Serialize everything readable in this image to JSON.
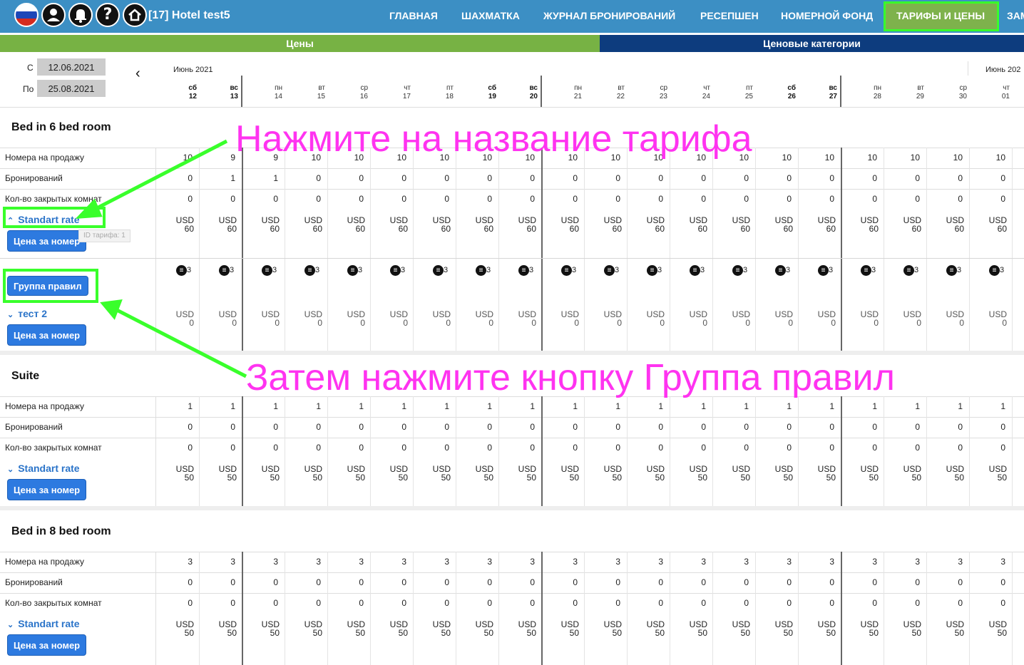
{
  "header": {
    "icons": [
      "flag-icon",
      "profile-icon",
      "bell-icon",
      "help-icon",
      "home-icon"
    ],
    "hotel_name": "[17] Hotel test5",
    "nav": [
      "ГЛАВНАЯ",
      "ШАХМАТКА",
      "ЖУРНАЛ БРОНИРОВАНИЙ",
      "РЕСЕПШЕН",
      "НОМЕРНОЙ ФОНД",
      "ТАРИФЫ И ЦЕНЫ",
      "ЗАМ"
    ],
    "active_nav": "ТАРИФЫ И ЦЕНЫ"
  },
  "tabs": {
    "prices": "Цены",
    "categories": "Ценовые категории"
  },
  "filter": {
    "from_label": "С",
    "from_value": "12.06.2021",
    "to_label": "По",
    "to_value": "25.08.2021",
    "prev": "‹"
  },
  "calendar": {
    "month": "Июнь 2021",
    "month_next": "Июнь 202",
    "days": [
      {
        "wd": "сб",
        "d": "12"
      },
      {
        "wd": "вс",
        "d": "13"
      },
      {
        "wd": "пн",
        "d": "14"
      },
      {
        "wd": "вт",
        "d": "15"
      },
      {
        "wd": "ср",
        "d": "16"
      },
      {
        "wd": "чт",
        "d": "17"
      },
      {
        "wd": "пт",
        "d": "18"
      },
      {
        "wd": "сб",
        "d": "19"
      },
      {
        "wd": "вс",
        "d": "20"
      },
      {
        "wd": "пн",
        "d": "21"
      },
      {
        "wd": "вт",
        "d": "22"
      },
      {
        "wd": "ср",
        "d": "23"
      },
      {
        "wd": "чт",
        "d": "24"
      },
      {
        "wd": "пт",
        "d": "25"
      },
      {
        "wd": "сб",
        "d": "26"
      },
      {
        "wd": "вс",
        "d": "27"
      },
      {
        "wd": "пн",
        "d": "28"
      },
      {
        "wd": "вт",
        "d": "29"
      },
      {
        "wd": "ср",
        "d": "30"
      },
      {
        "wd": "чт",
        "d": "01"
      }
    ]
  },
  "row_labels": {
    "sale": "Номера на продажу",
    "bookings": "Бронирований",
    "closed": "Кол-во закрытых комнат"
  },
  "currency": "USD",
  "price_button": "Цена за номер",
  "rules_button": "Группа правил",
  "rules_symbol": "3",
  "tooltip": "ID тарифа: 1",
  "rooms": [
    {
      "name": "Bed in 6 bed room",
      "sale": [
        "10",
        "9",
        "9",
        "10",
        "10",
        "10",
        "10",
        "10",
        "10",
        "10",
        "10",
        "10",
        "10",
        "10",
        "10",
        "10",
        "10",
        "10",
        "10",
        "10"
      ],
      "bookings": [
        "0",
        "1",
        "1",
        "0",
        "0",
        "0",
        "0",
        "0",
        "0",
        "0",
        "0",
        "0",
        "0",
        "0",
        "0",
        "0",
        "0",
        "0",
        "0",
        "0"
      ],
      "closed": [
        "0",
        "0",
        "0",
        "0",
        "0",
        "0",
        "0",
        "0",
        "0",
        "0",
        "0",
        "0",
        "0",
        "0",
        "0",
        "0",
        "0",
        "0",
        "0",
        "0"
      ],
      "rates": [
        {
          "name": "Standart rate",
          "expanded": true,
          "price": "60"
        },
        {
          "name": "тест 2",
          "expanded": false,
          "price": "0"
        }
      ]
    },
    {
      "name": "Suite",
      "sale": [
        "1",
        "1",
        "1",
        "1",
        "1",
        "1",
        "1",
        "1",
        "1",
        "1",
        "1",
        "1",
        "1",
        "1",
        "1",
        "1",
        "1",
        "1",
        "1",
        "1"
      ],
      "bookings": [
        "0",
        "0",
        "0",
        "0",
        "0",
        "0",
        "0",
        "0",
        "0",
        "0",
        "0",
        "0",
        "0",
        "0",
        "0",
        "0",
        "0",
        "0",
        "0",
        "0"
      ],
      "closed": [
        "0",
        "0",
        "0",
        "0",
        "0",
        "0",
        "0",
        "0",
        "0",
        "0",
        "0",
        "0",
        "0",
        "0",
        "0",
        "0",
        "0",
        "0",
        "0",
        "0"
      ],
      "rates": [
        {
          "name": "Standart rate",
          "expanded": false,
          "price": "50"
        }
      ]
    },
    {
      "name": "Bed in 8 bed room",
      "sale": [
        "3",
        "3",
        "3",
        "3",
        "3",
        "3",
        "3",
        "3",
        "3",
        "3",
        "3",
        "3",
        "3",
        "3",
        "3",
        "3",
        "3",
        "3",
        "3",
        "3"
      ],
      "bookings": [
        "0",
        "0",
        "0",
        "0",
        "0",
        "0",
        "0",
        "0",
        "0",
        "0",
        "0",
        "0",
        "0",
        "0",
        "0",
        "0",
        "0",
        "0",
        "0",
        "0"
      ],
      "closed": [
        "0",
        "0",
        "0",
        "0",
        "0",
        "0",
        "0",
        "0",
        "0",
        "0",
        "0",
        "0",
        "0",
        "0",
        "0",
        "0",
        "0",
        "0",
        "0",
        "0"
      ],
      "rates": [
        {
          "name": "Standart rate",
          "expanded": false,
          "price": "50"
        }
      ]
    }
  ],
  "annotations": {
    "top": "Нажмите на название тарифа",
    "bottom": "Затем нажмите кнопку Группа правил"
  },
  "colors": {
    "topbar": "#3c8fc4",
    "tab_prices": "#77b244",
    "tab_categories": "#0d3c7e",
    "highlight": "#39ff2b",
    "annotation": "#ff33f0",
    "closed_rate": "#fcbf70"
  }
}
